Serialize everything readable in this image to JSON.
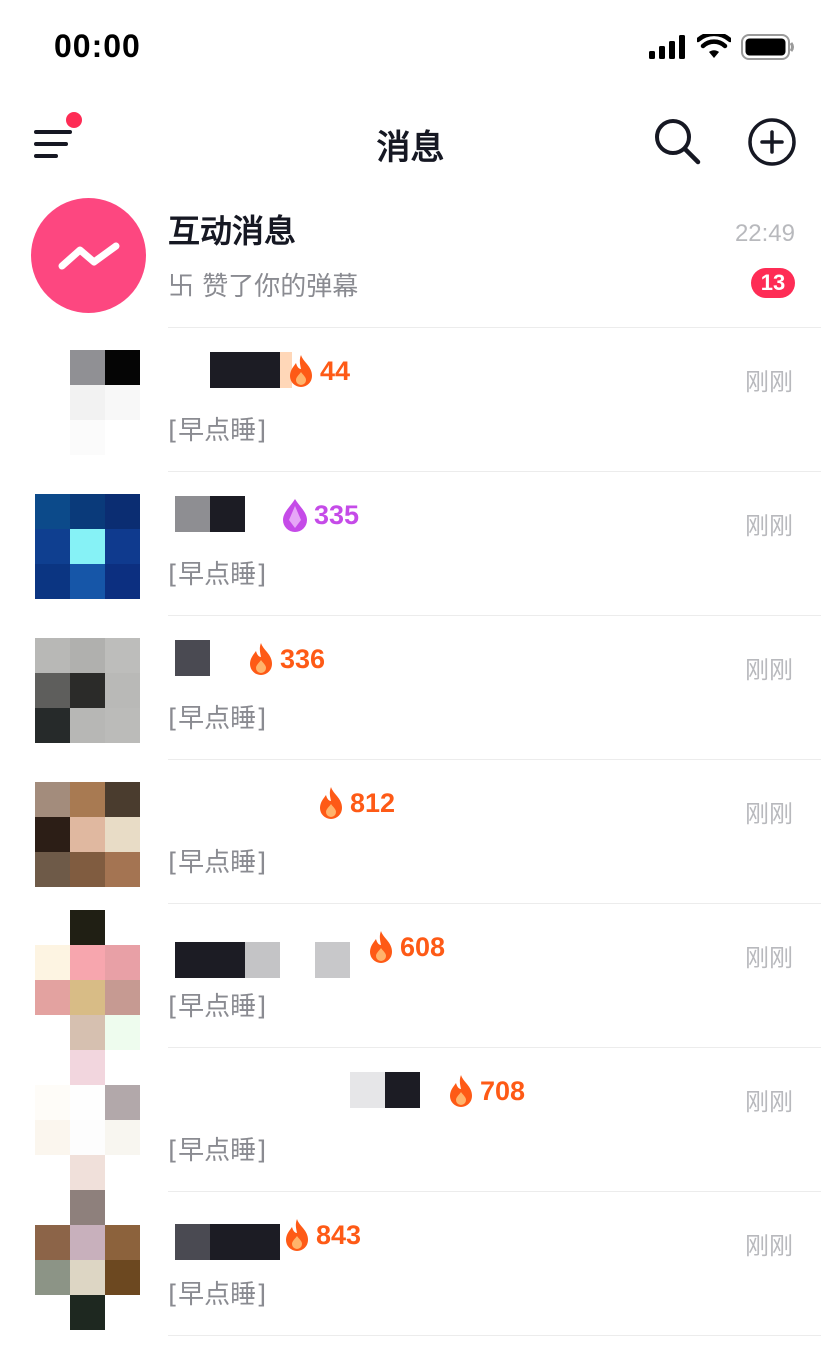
{
  "status_bar": {
    "time": "00:00"
  },
  "header": {
    "title": "消息"
  },
  "interaction": {
    "title": "互动消息",
    "subtitle": "卐 赞了你的弹幕",
    "time": "22:49",
    "badge": "13"
  },
  "chats": [
    {
      "streak": "44",
      "streak_type": "fire",
      "preview": "[早点睡]",
      "time": "刚刚"
    },
    {
      "streak": "335",
      "streak_type": "crystal",
      "preview": "[早点睡]",
      "time": "刚刚"
    },
    {
      "streak": "336",
      "streak_type": "fire",
      "preview": "[早点睡]",
      "time": "刚刚"
    },
    {
      "streak": "812",
      "streak_type": "fire",
      "preview": "[早点睡]",
      "time": "刚刚"
    },
    {
      "streak": "608",
      "streak_type": "fire",
      "preview": "[早点睡]",
      "time": "刚刚"
    },
    {
      "streak": "708",
      "streak_type": "fire",
      "preview": "[早点睡]",
      "time": "刚刚"
    },
    {
      "streak": "843",
      "streak_type": "fire",
      "preview": "[早点睡]",
      "time": "刚刚"
    }
  ],
  "colors": {
    "accent": "#fe2c55",
    "interaction_avatar": "#fd4780",
    "fire": "#fe5a16",
    "crystal": "#c54be8",
    "muted_text": "#8a8b91",
    "time_text": "#b8b9bd"
  }
}
